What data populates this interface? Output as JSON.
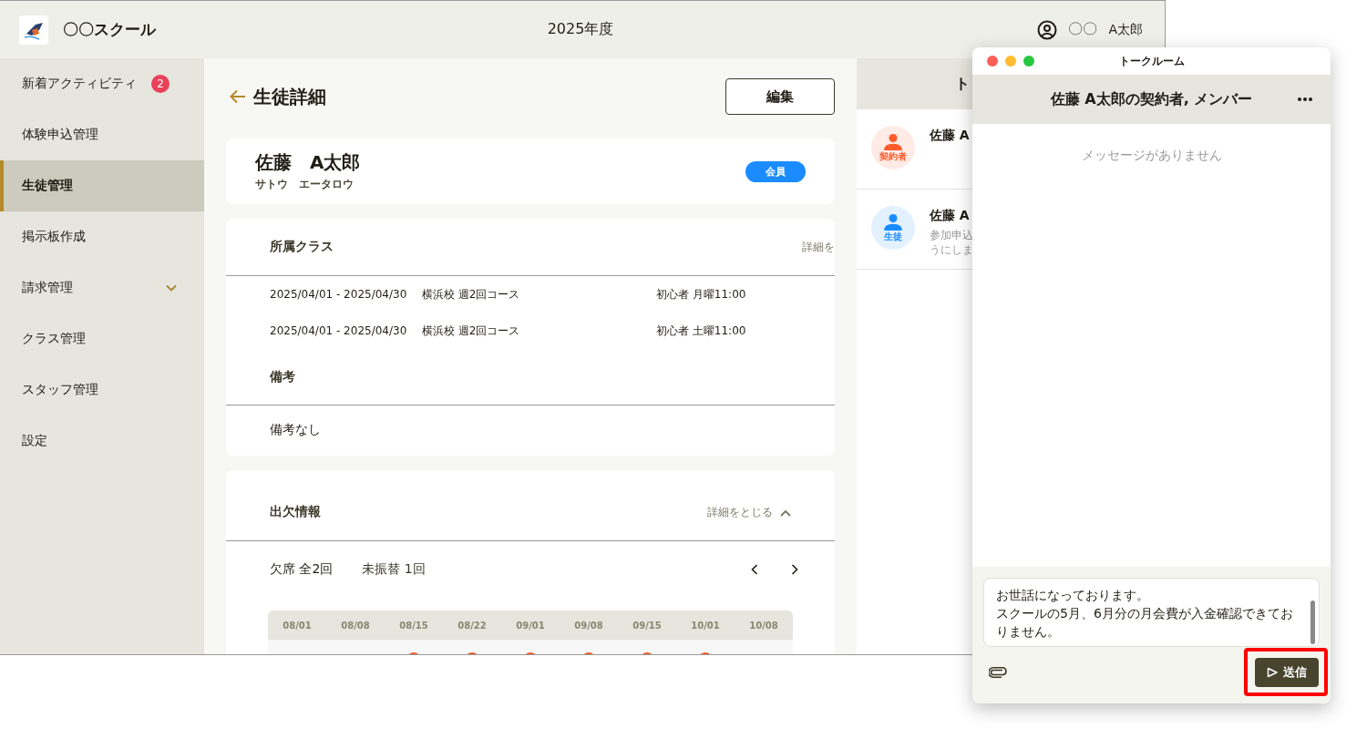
{
  "header": {
    "school_name": "〇〇スクール",
    "fiscal_year": "2025年度",
    "user_org": "〇〇",
    "user_name": "A太郎"
  },
  "sidebar": {
    "items": [
      {
        "kind": "link",
        "label": "新着アクティビティ",
        "badge": "2",
        "selected": false
      },
      {
        "kind": "link",
        "label": "体験申込管理",
        "selected": false
      },
      {
        "kind": "link",
        "label": "生徒管理",
        "selected": true
      },
      {
        "kind": "link",
        "label": "掲示板作成",
        "selected": false
      },
      {
        "kind": "group",
        "label": "請求管理",
        "selected": false,
        "expanded": false
      },
      {
        "kind": "link",
        "label": "クラス管理",
        "selected": false
      },
      {
        "kind": "link",
        "label": "スタッフ管理",
        "selected": false
      },
      {
        "kind": "link",
        "label": "設定",
        "selected": false
      }
    ]
  },
  "page": {
    "title": "生徒詳細",
    "edit_button": "編集"
  },
  "student": {
    "name": "佐藤　A太郎",
    "kana": "サトウ　エータロウ",
    "badge": "会員"
  },
  "classes": {
    "title": "所属クラス",
    "toggle": "詳細を",
    "rows": [
      {
        "period": "2025/04/01 - 2025/04/30",
        "course": "横浜校 週2回コース",
        "schedule": "初心者 月曜11:00"
      },
      {
        "period": "2025/04/01 - 2025/04/30",
        "course": "横浜校 週2回コース",
        "schedule": "初心者 土曜11:00"
      }
    ],
    "notes_title": "備考",
    "notes": "備考なし"
  },
  "attendance": {
    "title": "出欠情報",
    "toggle": "詳細をとじる",
    "absences": "欠席 全2回",
    "unmoved": "未振替 1回",
    "dates": [
      {
        "label": "08/01",
        "marked": false
      },
      {
        "label": "08/08",
        "marked": false
      },
      {
        "label": "08/15",
        "marked": true
      },
      {
        "label": "08/22",
        "marked": true
      },
      {
        "label": "09/01",
        "marked": true
      },
      {
        "label": "09/08",
        "marked": true
      },
      {
        "label": "09/15",
        "marked": true
      },
      {
        "label": "10/01",
        "marked": true
      },
      {
        "label": "10/08",
        "marked": false
      }
    ]
  },
  "talk_list": {
    "title": "ト",
    "items": [
      {
        "role_label": "契約者",
        "color": "#ff5a2a",
        "name": "佐藤 A"
      },
      {
        "role_label": "生徒",
        "color": "#1a8cff",
        "name": "佐藤 A",
        "preview": [
          "参加申込",
          "うにしま"
        ]
      }
    ]
  },
  "chat": {
    "window_title": "トークルーム",
    "room_title": "佐藤 A太郎の契約者, メンバー",
    "empty_text": "メッセージがありません",
    "draft": [
      "お世話になっております。",
      "スクールの5月、6月分の月会費が入金確認できておりません。"
    ],
    "send_button": "送信",
    "send_highlighted": true
  }
}
